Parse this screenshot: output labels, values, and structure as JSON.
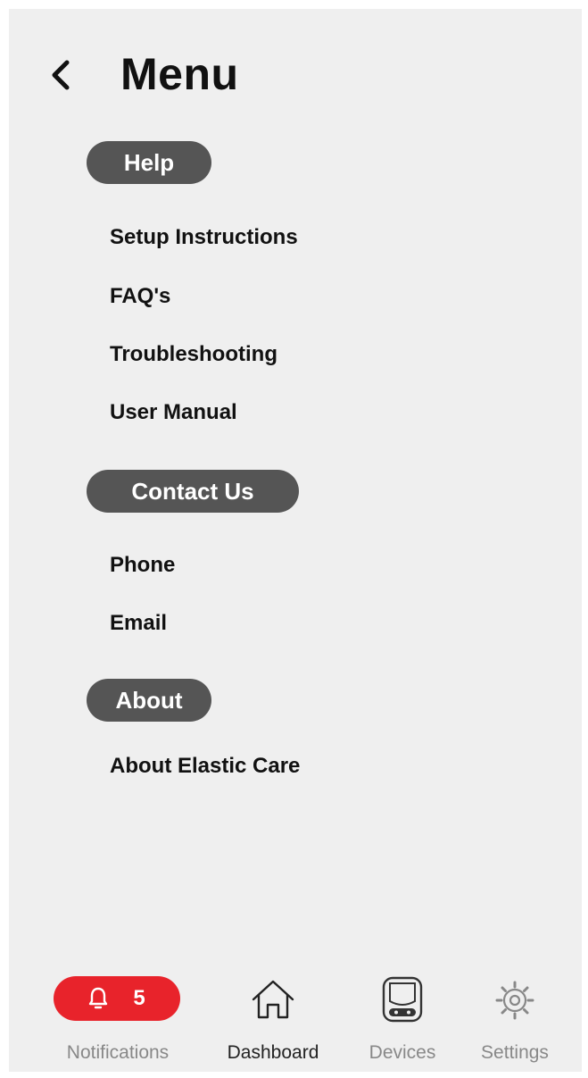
{
  "header": {
    "title": "Menu"
  },
  "sections": {
    "help": {
      "label": "Help",
      "items": [
        "Setup Instructions",
        "FAQ's",
        "Troubleshooting",
        "User Manual"
      ]
    },
    "contact": {
      "label": "Contact Us",
      "items": [
        "Phone",
        "Email"
      ]
    },
    "about": {
      "label": "About",
      "items": [
        "About Elastic Care"
      ]
    }
  },
  "nav": {
    "notifications": {
      "label": "Notifications",
      "count": "5",
      "icon": "bell-icon"
    },
    "dashboard": {
      "label": "Dashboard",
      "icon": "home-icon",
      "active": true
    },
    "devices": {
      "label": "Devices",
      "icon": "device-icon"
    },
    "settings": {
      "label": "Settings",
      "icon": "gear-icon"
    }
  },
  "colors": {
    "background": "#efefef",
    "pill": "#555555",
    "accent": "#e8232b",
    "text": "#111111",
    "inactive": "#888888"
  }
}
